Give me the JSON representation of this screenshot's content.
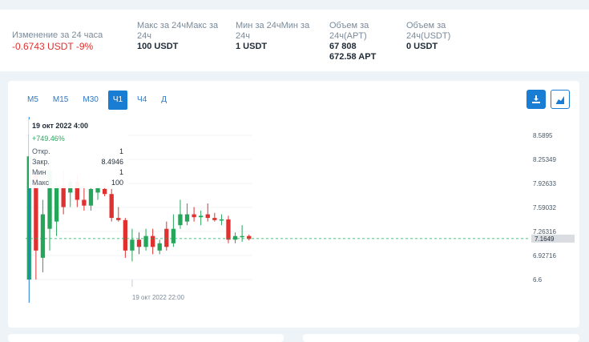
{
  "stats": {
    "change": {
      "label": "Изменение за 24 часа",
      "value": "-0.6743 USDT -9%"
    },
    "max": {
      "label_line1": "Макс за 24чМакс за",
      "label_line2": "24ч",
      "value": "100 USDT"
    },
    "min": {
      "label_line1": "Мин за 24чМин за",
      "label_line2": "24ч",
      "value": "1 USDT"
    },
    "vol_apt": {
      "label_line1": "Объем за",
      "label_line2": "24ч(APT)",
      "value_line1": "67 808",
      "value_line2": "672.58 APT"
    },
    "vol_usdt": {
      "label_line1": "Объем за",
      "label_line2": "24ч(USDT)",
      "value": "0 USDT"
    }
  },
  "timeframes": [
    "M5",
    "M15",
    "M30",
    "Ч1",
    "Ч4",
    "Д"
  ],
  "active_timeframe": "Ч1",
  "toolbar": {
    "left_icon": "download-icon",
    "right_icon": "area-chart-icon"
  },
  "tooltip": {
    "date": "19 окт 2022 4:00",
    "change": "+749.46%",
    "rows": [
      {
        "label": "Откр.",
        "value": "1"
      },
      {
        "label": "Закр.",
        "value": "8.4946"
      },
      {
        "label": "Мин",
        "value": "1"
      },
      {
        "label": "Макс",
        "value": "100"
      }
    ]
  },
  "colors": {
    "up": "#26a65b",
    "down": "#e03131",
    "accent": "#1a7dd4",
    "negative_text": "#e03131"
  },
  "chart_data": {
    "type": "candlestick",
    "y_ticks": [
      "8.5895",
      "8.25349",
      "7.92633",
      "7.59032",
      "7.26316",
      "6.92716",
      "6.6"
    ],
    "ylim": [
      6.6,
      8.5895
    ],
    "last_price": "7.1649",
    "last_price_value": 7.1649,
    "x_tick_label": "19 окт 2022 22:00",
    "candles": [
      {
        "o": 6.6,
        "h": 8.6,
        "l": 6.6,
        "c": 8.3
      },
      {
        "o": 8.1,
        "h": 8.3,
        "l": 6.6,
        "c": 7.0
      },
      {
        "o": 6.9,
        "h": 7.7,
        "l": 6.7,
        "c": 7.5
      },
      {
        "o": 7.3,
        "h": 8.3,
        "l": 7.0,
        "c": 8.1
      },
      {
        "o": 7.4,
        "h": 8.0,
        "l": 7.2,
        "c": 7.9
      },
      {
        "o": 7.9,
        "h": 8.1,
        "l": 7.5,
        "c": 7.6
      },
      {
        "o": 7.8,
        "h": 8.0,
        "l": 7.6,
        "c": 7.95
      },
      {
        "o": 7.95,
        "h": 8.05,
        "l": 7.6,
        "c": 7.7
      },
      {
        "o": 7.7,
        "h": 7.9,
        "l": 7.55,
        "c": 7.62
      },
      {
        "o": 7.62,
        "h": 7.9,
        "l": 7.55,
        "c": 7.85
      },
      {
        "o": 7.8,
        "h": 7.95,
        "l": 7.7,
        "c": 7.88
      },
      {
        "o": 7.85,
        "h": 7.95,
        "l": 7.75,
        "c": 7.78
      },
      {
        "o": 7.78,
        "h": 7.85,
        "l": 7.4,
        "c": 7.45
      },
      {
        "o": 7.45,
        "h": 7.6,
        "l": 7.4,
        "c": 7.42
      },
      {
        "o": 7.42,
        "h": 7.45,
        "l": 6.9,
        "c": 7.0
      },
      {
        "o": 7.0,
        "h": 7.3,
        "l": 6.85,
        "c": 7.15
      },
      {
        "o": 7.15,
        "h": 7.25,
        "l": 6.95,
        "c": 7.05
      },
      {
        "o": 7.05,
        "h": 7.3,
        "l": 7.0,
        "c": 7.2
      },
      {
        "o": 7.2,
        "h": 7.3,
        "l": 6.95,
        "c": 7.05
      },
      {
        "o": 7.0,
        "h": 7.15,
        "l": 6.95,
        "c": 7.1
      },
      {
        "o": 7.3,
        "h": 7.4,
        "l": 7.0,
        "c": 7.05
      },
      {
        "o": 7.1,
        "h": 7.5,
        "l": 7.05,
        "c": 7.3
      },
      {
        "o": 7.35,
        "h": 7.7,
        "l": 7.3,
        "c": 7.5
      },
      {
        "o": 7.4,
        "h": 7.65,
        "l": 7.35,
        "c": 7.5
      },
      {
        "o": 7.5,
        "h": 7.6,
        "l": 7.4,
        "c": 7.46
      },
      {
        "o": 7.46,
        "h": 7.55,
        "l": 7.35,
        "c": 7.48
      },
      {
        "o": 7.5,
        "h": 7.65,
        "l": 7.4,
        "c": 7.45
      },
      {
        "o": 7.45,
        "h": 7.52,
        "l": 7.4,
        "c": 7.42
      },
      {
        "o": 7.42,
        "h": 7.5,
        "l": 7.35,
        "c": 7.43
      },
      {
        "o": 7.43,
        "h": 7.48,
        "l": 7.1,
        "c": 7.15
      },
      {
        "o": 7.15,
        "h": 7.25,
        "l": 7.1,
        "c": 7.2
      },
      {
        "o": 7.2,
        "h": 7.35,
        "l": 7.12,
        "c": 7.2
      },
      {
        "o": 7.2,
        "h": 7.22,
        "l": 7.14,
        "c": 7.16
      }
    ]
  }
}
